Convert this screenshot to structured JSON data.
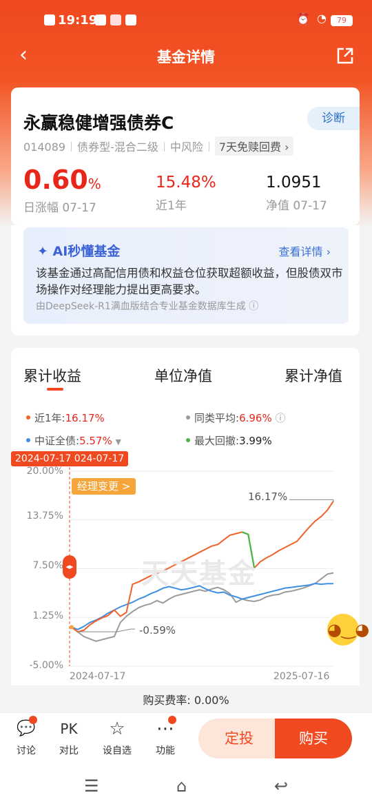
{
  "status": {
    "time": "19:19",
    "battery": "79"
  },
  "header": {
    "title": "基金详情"
  },
  "fund": {
    "name": "永赢稳健增强债券C",
    "diagnose_label": "诊断",
    "code": "014089",
    "category": "债券型-混合二级",
    "risk": "中风险",
    "redeem_tag": "7天免赎回费 ›",
    "daily_change": "0.60",
    "daily_change_unit": "%",
    "daily_change_label": "日涨幅 07-17",
    "year_return": "15.48%",
    "year_return_label": "近1年",
    "nav": "1.0951",
    "nav_label": "净值 07-17"
  },
  "ai": {
    "title": "AI秒懂基金",
    "more": "查看详情 ›",
    "body": "该基金通过高配信用债和权益仓位获取超额收益，但股债双市场操作对经理能力提出更高要求。",
    "source": "由DeepSeek-R1满血版结合专业基金数据库生成 ⓘ"
  },
  "tabs": [
    "累计收益",
    "单位净值",
    "累计净值"
  ],
  "legend": {
    "fund_label": "近1年:",
    "fund_value": "16.17%",
    "peer_label": "同类平均:",
    "peer_value": "6.96%",
    "index_label": "中证全债:",
    "index_value": "5.57%",
    "dd_label": "最大回撤:",
    "dd_value": "3.99%"
  },
  "chart": {
    "date_badge": "2024-07-17  024-07-17",
    "manager_change": "经理变更 >",
    "end_label": "16.17%",
    "min_label": "-0.59%",
    "watermark": "天天基金",
    "y_ticks": [
      "20.00%",
      "13.75%",
      "7.50%",
      "1.25%",
      "-5.00%"
    ],
    "x_start": "2024-07-17",
    "x_end": "2025-07-16"
  },
  "chart_data": {
    "type": "line",
    "ylim": [
      -5,
      20
    ],
    "y_ticks": [
      "20.00%",
      "13.75%",
      "7.50%",
      "1.25%",
      "-5.00%"
    ],
    "x_labels": [
      "2024-07-17",
      "2025-07-16"
    ],
    "colors": {
      "fund": "#f0622a",
      "peer": "#9a9a9a",
      "index": "#3d8fe0",
      "drawdown": "#45b845"
    },
    "series": [
      {
        "name": "近1年",
        "values": [
          0,
          -0.59,
          -0.4,
          0.3,
          0.8,
          1.2,
          1.5,
          2.2,
          1.4,
          1.9,
          5.5,
          5.8,
          6.2,
          6.6,
          6.9,
          7.2,
          7.6,
          8.0,
          8.4,
          8.8,
          9.2,
          9.6,
          10.0,
          10.4,
          10.6,
          11.2,
          11.8,
          12.0,
          12.2,
          11.9,
          7.6,
          8.4,
          8.9,
          9.3,
          9.8,
          10.2,
          10.6,
          11.0,
          11.9,
          12.8,
          13.6,
          14.2,
          15.0,
          16.17
        ]
      },
      {
        "name": "同类平均",
        "values": [
          0,
          -0.6,
          -1.2,
          -1.5,
          -1.8,
          -1.6,
          -1.4,
          -1.2,
          0.6,
          1.4,
          2.0,
          2.5,
          2.8,
          3.0,
          3.4,
          3.1,
          3.6,
          4.0,
          4.2,
          4.4,
          4.6,
          4.8,
          4.6,
          4.9,
          5.1,
          4.8,
          4.3,
          3.2,
          3.6,
          3.4,
          3.3,
          3.5,
          3.9,
          4.1,
          4.2,
          4.5,
          4.6,
          4.8,
          5.0,
          5.3,
          5.6,
          6.2,
          6.8,
          6.96
        ]
      },
      {
        "name": "中证全债",
        "values": [
          0,
          -0.3,
          0.1,
          0.6,
          0.9,
          1.3,
          1.8,
          2.2,
          2.6,
          2.9,
          3.2,
          3.6,
          3.9,
          4.3,
          4.6,
          5.0,
          5.2,
          5.0,
          4.8,
          4.9,
          5.1,
          5.3,
          4.9,
          4.6,
          4.4,
          4.5,
          4.1,
          3.9,
          3.6,
          3.8,
          4.0,
          4.2,
          4.4,
          4.6,
          4.8,
          5.0,
          5.1,
          5.2,
          5.3,
          5.4,
          5.6,
          5.5,
          5.57,
          5.57
        ]
      }
    ]
  },
  "fee": {
    "label": "购买费率: 0.00%"
  },
  "bottom": {
    "items": [
      {
        "icon": "💬",
        "label": "讨论"
      },
      {
        "icon": "PK",
        "label": "对比"
      },
      {
        "icon": "☆",
        "label": "设自选"
      },
      {
        "icon": "⋯",
        "label": "功能"
      }
    ],
    "dingtou": "定投",
    "buy": "购买"
  }
}
